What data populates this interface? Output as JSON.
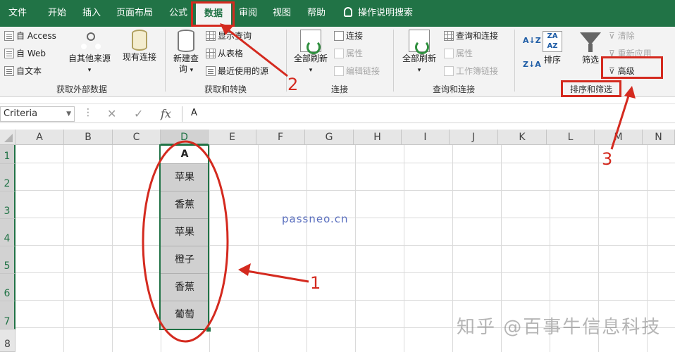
{
  "tabs": [
    {
      "label": "文件",
      "active": false
    },
    {
      "label": "开始",
      "active": false
    },
    {
      "label": "插入",
      "active": false
    },
    {
      "label": "页面布局",
      "active": false
    },
    {
      "label": "公式",
      "active": false
    },
    {
      "label": "数据",
      "active": true
    },
    {
      "label": "审阅",
      "active": false
    },
    {
      "label": "视图",
      "active": false
    },
    {
      "label": "帮助",
      "active": false
    }
  ],
  "tell_me": "操作说明搜索",
  "ribbon": {
    "get_external": {
      "access": "自 Access",
      "web": "自 Web",
      "text": "自文本",
      "other_sources": "自其他来源",
      "existing": "现有连接",
      "label": "获取外部数据"
    },
    "get_transform": {
      "new_query_line1": "新建查",
      "new_query_line2": "询",
      "show_queries": "显示查询",
      "from_table": "从表格",
      "recent_sources": "最近使用的源",
      "label": "获取和转换"
    },
    "connections": {
      "refresh_all": "全部刷新",
      "connections": "连接",
      "properties": "属性",
      "edit_links": "编辑链接",
      "label": "连接"
    },
    "queries_connections": {
      "refresh_all": "全部刷新",
      "queries_and_connections": "查询和连接",
      "properties": "属性",
      "workbook_links": "工作簿链接",
      "label": "查询和连接"
    },
    "sort_filter": {
      "az": "A↓Z",
      "za": "Z↓A",
      "sort_icon_top": "ZA",
      "sort_icon_bottom": "AZ",
      "sort": "排序",
      "filter": "筛选",
      "clear": "清除",
      "reapply": "重新应用",
      "advanced": "高级",
      "label": "排序和筛选"
    }
  },
  "formula_bar": {
    "name_box": "Criteria",
    "cancel": "✕",
    "enter": "✓",
    "fx": "fx",
    "value": "A"
  },
  "columns": [
    "A",
    "B",
    "C",
    "D",
    "E",
    "F",
    "G",
    "H",
    "I",
    "J",
    "K",
    "L",
    "M",
    "N"
  ],
  "rows": [
    "1",
    "2",
    "3",
    "4",
    "5",
    "6",
    "7",
    "8"
  ],
  "cells_D": [
    "A",
    "苹果",
    "香蕉",
    "苹果",
    "橙子",
    "香蕉",
    "葡萄"
  ],
  "annotations": {
    "n1": "1",
    "n2": "2",
    "n3": "3"
  },
  "watermark": "passneo.cn",
  "zhihu_mark": "知乎 @百事牛信息科技",
  "colors": {
    "excel_green": "#217346",
    "annotation_red": "#d42a1f",
    "filled_cell": "#d0d0d0"
  }
}
